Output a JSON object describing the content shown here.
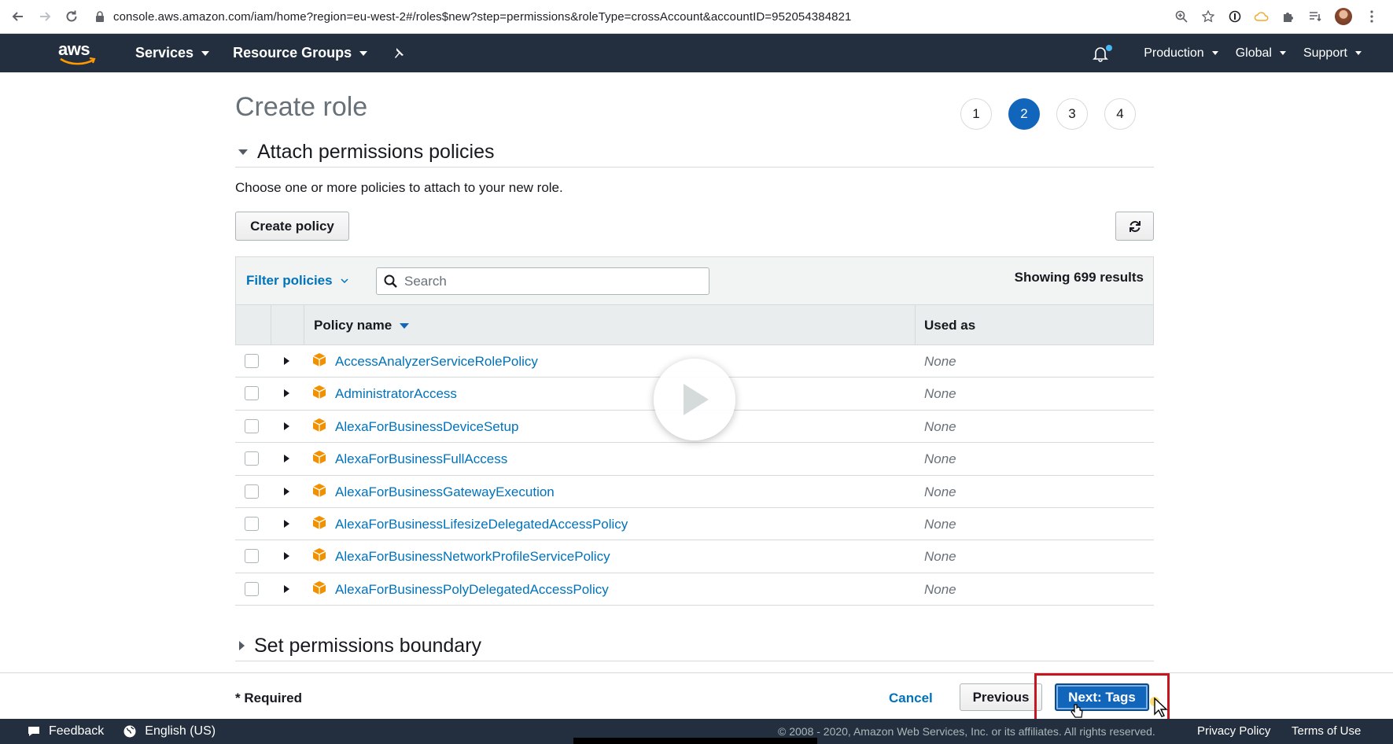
{
  "browser": {
    "url": "console.aws.amazon.com/iam/home?region=eu-west-2#/roles$new?step=permissions&roleType=crossAccount&accountID=952054384821"
  },
  "nav": {
    "logo": "aws",
    "services": "Services",
    "resource_groups": "Resource Groups",
    "account": "Production",
    "region": "Global",
    "support": "Support"
  },
  "page": {
    "title": "Create role",
    "steps": [
      "1",
      "2",
      "3",
      "4"
    ],
    "active_step": 2
  },
  "permissions": {
    "section_title": "Attach permissions policies",
    "description": "Choose one or more policies to attach to your new role.",
    "create_policy": "Create policy",
    "filter_label": "Filter policies",
    "search_placeholder": "Search",
    "results": "Showing 699 results",
    "columns": {
      "name": "Policy name",
      "used_as": "Used as"
    },
    "rows": [
      {
        "name": "AccessAnalyzerServiceRolePolicy",
        "used_as": "None"
      },
      {
        "name": "AdministratorAccess",
        "used_as": "None"
      },
      {
        "name": "AlexaForBusinessDeviceSetup",
        "used_as": "None"
      },
      {
        "name": "AlexaForBusinessFullAccess",
        "used_as": "None"
      },
      {
        "name": "AlexaForBusinessGatewayExecution",
        "used_as": "None"
      },
      {
        "name": "AlexaForBusinessLifesizeDelegatedAccessPolicy",
        "used_as": "None"
      },
      {
        "name": "AlexaForBusinessNetworkProfileServicePolicy",
        "used_as": "None"
      },
      {
        "name": "AlexaForBusinessPolyDelegatedAccessPolicy",
        "used_as": "None"
      }
    ]
  },
  "boundary": {
    "section_title": "Set permissions boundary"
  },
  "actions": {
    "required": "* Required",
    "cancel": "Cancel",
    "previous": "Previous",
    "next": "Next: Tags"
  },
  "footer": {
    "feedback": "Feedback",
    "language": "English (US)",
    "copyright": "© 2008 - 2020, Amazon Web Services, Inc. or its affiliates. All rights reserved.",
    "privacy": "Privacy Policy",
    "terms": "Terms of Use"
  },
  "colors": {
    "aws_nav": "#232f3e",
    "link": "#0073bb",
    "primary_button": "#1166bb",
    "policy_icon": "#f29100",
    "highlight": "#c7161d"
  }
}
